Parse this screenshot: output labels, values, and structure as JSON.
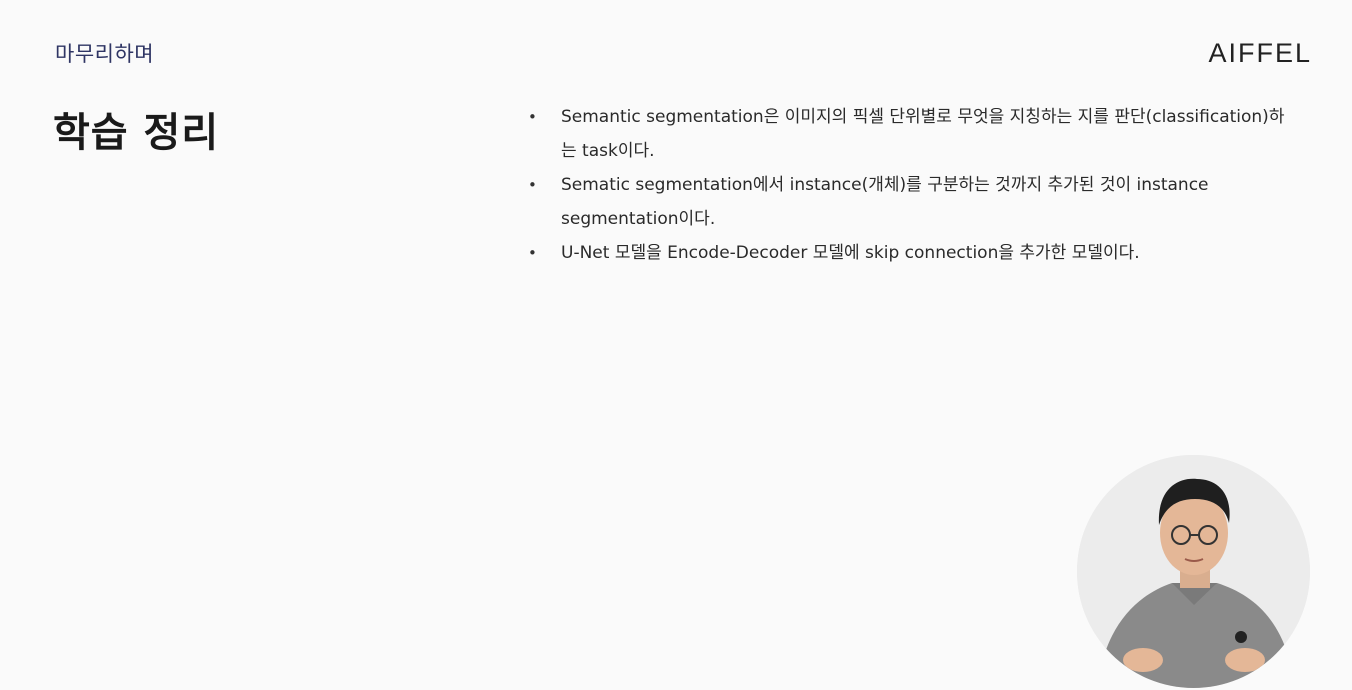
{
  "header": {
    "section_label": "마무리하며",
    "logo_text": "AIFFEL"
  },
  "main": {
    "title": "학습 정리",
    "bullets": [
      "Semantic segmentation은 이미지의 픽셀 단위별로 무엇을 지칭하는 지를 판단(classification)하는 task이다.",
      "Sematic segmentation에서 instance(개체)를 구분하는 것까지 추가된 것이 instance segmentation이다.",
      "U-Net 모델을 Encode-Decoder 모델에 skip connection을 추가한 모델이다."
    ]
  },
  "presenter": {
    "icon": "presenter-video-icon"
  },
  "colors": {
    "background": "#fafafa",
    "section_label": "#2f3564",
    "shirt": "#8a8a8a"
  }
}
